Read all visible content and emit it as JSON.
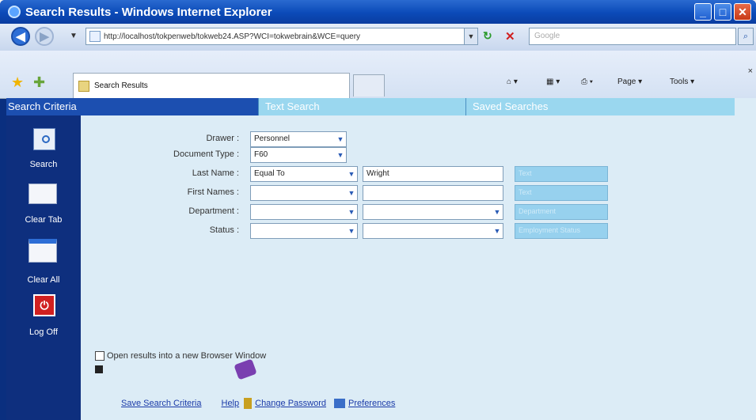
{
  "browser": {
    "title": "Search Results - Windows Internet Explorer",
    "address": "http://localhost/tokpenweb/tokweb24.ASP?WCI=tokwebrain&WCE=query",
    "search_placeholder": "Google",
    "tab_title": "Search Results",
    "tools": {
      "page": "Page",
      "tools": "Tools"
    }
  },
  "app": {
    "tabs": [
      "Search Criteria",
      "Text Search",
      "Saved Searches"
    ],
    "sidebar": [
      {
        "label": "Search",
        "icon": "search-icon"
      },
      {
        "label": "Clear Tab",
        "icon": "clear-tab-icon"
      },
      {
        "label": "Clear All",
        "icon": "clear-all-icon"
      },
      {
        "label": "Log Off",
        "icon": "log-off-icon"
      }
    ],
    "form": {
      "drawer": {
        "label": "Drawer :",
        "value": "Personnel"
      },
      "doctype": {
        "label": "Document Type :",
        "value": "F60"
      },
      "lastname": {
        "label": "Last Name :",
        "operator": "Equal To",
        "value": "Wright",
        "hint": "Text"
      },
      "firstname": {
        "label": "First Names :",
        "operator": "",
        "value": "",
        "hint": "Text"
      },
      "department": {
        "label": "Department :",
        "operator": "",
        "value": "",
        "hint": "Department"
      },
      "status": {
        "label": "Status :",
        "operator": "",
        "value": "",
        "hint": "Employment Status"
      }
    },
    "open_new_window": "Open results into a new Browser Window",
    "footer": {
      "save": "Save Search Criteria",
      "help": "Help",
      "change_password": "Change Password",
      "preferences": "Preferences"
    }
  }
}
